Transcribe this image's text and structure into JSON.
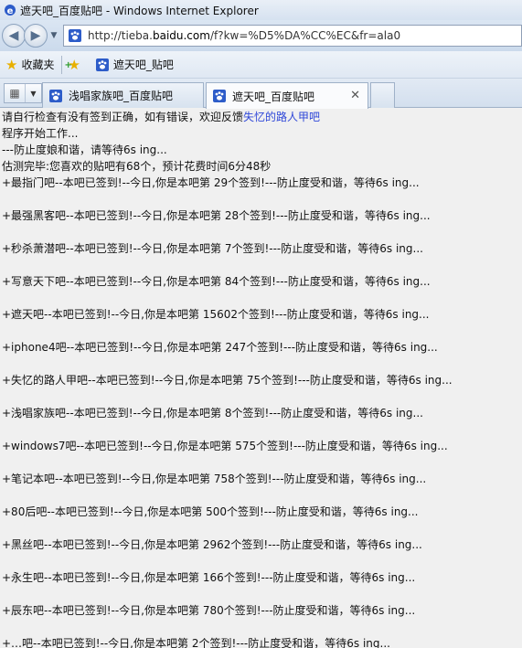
{
  "window": {
    "title": "遮天吧_百度贴吧 - Windows Internet Explorer"
  },
  "address_bar": {
    "url_prefix": "http://tieba.",
    "url_domain": "baidu.com",
    "url_suffix": "/f?kw=%D5%DA%CC%EC&fr=ala0"
  },
  "favorites_bar": {
    "favorites_label": "收藏夹",
    "link_label": "遮天吧_贴吧"
  },
  "tabs": [
    {
      "label": "浅唱家族吧_百度贴吧",
      "active": false
    },
    {
      "label": "遮天吧_百度贴吧",
      "active": true
    }
  ],
  "content": {
    "intro_text": "请自行检查有没有签到正确，如有错误，欢迎反馈",
    "feedback_link": "失忆的路人甲吧",
    "start_line": "程序开始工作...",
    "wait_line": "---防止度娘和谐，请等待6s ing...",
    "detect_line": "估测完毕:您喜欢的贴吧有68个，预计花费时间6分48秒",
    "records": [
      "+最指门吧--本吧已签到!--今日,你是本吧第 29个签到!---防止度受和谐，等待6s ing...",
      "+最强黑客吧--本吧已签到!--今日,你是本吧第 28个签到!---防止度受和谐，等待6s ing...",
      "+秒杀萧潜吧--本吧已签到!--今日,你是本吧第 7个签到!---防止度受和谐，等待6s ing...",
      "+写意天下吧--本吧已签到!--今日,你是本吧第 84个签到!---防止度受和谐，等待6s ing...",
      "+遮天吧--本吧已签到!--今日,你是本吧第 15602个签到!---防止度受和谐，等待6s ing...",
      "+iphone4吧--本吧已签到!--今日,你是本吧第 247个签到!---防止度受和谐，等待6s ing...",
      "+失忆的路人甲吧--本吧已签到!--今日,你是本吧第 75个签到!---防止度受和谐，等待6s ing...",
      "+浅唱家族吧--本吧已签到!--今日,你是本吧第 8个签到!---防止度受和谐，等待6s ing...",
      "+windows7吧--本吧已签到!--今日,你是本吧第 575个签到!---防止度受和谐，等待6s ing...",
      "+笔记本吧--本吧已签到!--今日,你是本吧第 758个签到!---防止度受和谐，等待6s ing...",
      "+80后吧--本吧已签到!--今日,你是本吧第 500个签到!---防止度受和谐，等待6s ing...",
      "+黑丝吧--本吧已签到!--今日,你是本吧第 2962个签到!---防止度受和谐，等待6s ing...",
      "+永生吧--本吧已签到!--今日,你是本吧第 166个签到!---防止度受和谐，等待6s ing...",
      "+辰东吧--本吧已签到!--今日,你是本吧第 780个签到!---防止度受和谐，等待6s ing...",
      "+…吧--本吧已签到!--今日,你是本吧第 2个签到!---防止度受和谐，等待6s ing..."
    ]
  },
  "colors": {
    "link": "#2f47d8",
    "ie_blue": "#2d5cc9"
  },
  "icons": {
    "app": "ie-icon",
    "favicon": "baidu-paw-icon",
    "back": "back-arrow-icon",
    "forward": "forward-arrow-icon",
    "favorites": "star-icon",
    "add_favorite": "add-favorite-icon",
    "quick_tabs": "quick-tabs-icon",
    "close_tab": "close-icon"
  }
}
